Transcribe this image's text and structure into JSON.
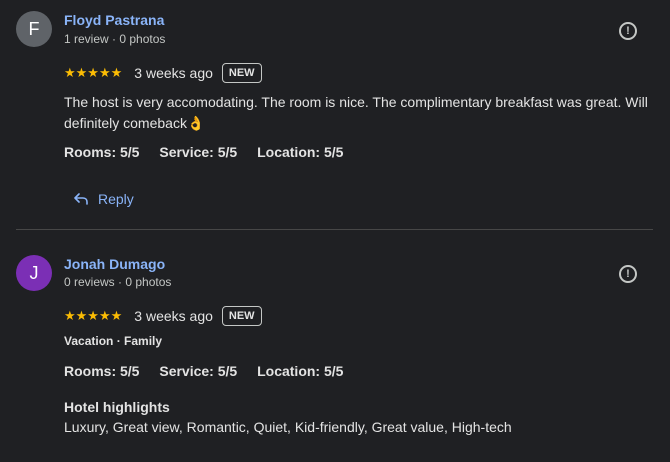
{
  "colors": {
    "background": "#1f2023",
    "link": "#8ab4f8",
    "star": "#fbbc04",
    "avatar_f": "#5f6368",
    "avatar_j": "#7b2fb5"
  },
  "reviews": [
    {
      "avatar_letter": "F",
      "author": "Floyd Pastrana",
      "meta": "1 review · 0 photos",
      "stars": "★★★★★",
      "rating": 5,
      "time": "3 weeks ago",
      "badge": "NEW",
      "text": "The host is very accomodating. The room is nice. The complimentary breakfast was great. Will definitely comeback👌",
      "subratings": {
        "rooms": "Rooms: 5/5",
        "service": "Service: 5/5",
        "location": "Location: 5/5"
      },
      "reply_label": "Reply"
    },
    {
      "avatar_letter": "J",
      "author": "Jonah Dumago",
      "meta": "0 reviews · 0 photos",
      "stars": "★★★★★",
      "rating": 5,
      "time": "3 weeks ago",
      "badge": "NEW",
      "trip_tags": "Vacation · Family",
      "subratings": {
        "rooms": "Rooms: 5/5",
        "service": "Service: 5/5",
        "location": "Location: 5/5"
      },
      "highlights_title": "Hotel highlights",
      "highlights_text": "Luxury, Great view, Romantic, Quiet, Kid-friendly, Great value, High-tech"
    }
  ],
  "icons": {
    "flag": "flag-icon",
    "reply": "reply-icon"
  }
}
